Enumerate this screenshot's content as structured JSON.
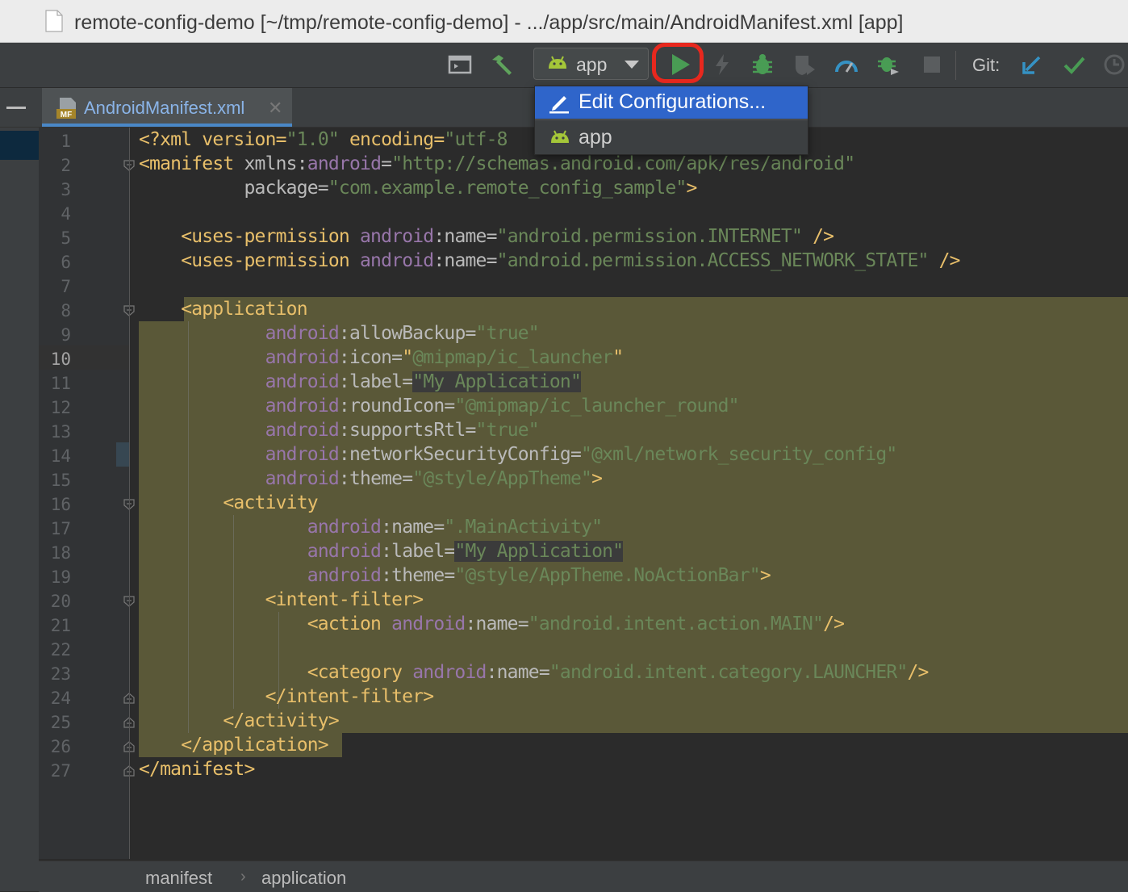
{
  "window": {
    "title": "remote-config-demo [~/tmp/remote-config-demo] - .../app/src/main/AndroidManifest.xml [app]"
  },
  "toolbar": {
    "config_value": "app",
    "git_label": "Git:",
    "icons": [
      "layout-icon",
      "build-hammer-icon",
      "android-icon",
      "chevron-down-icon",
      "run-play-icon",
      "apply-changes-icon",
      "debug-icon",
      "coverage-icon",
      "profile-icon",
      "attach-debugger-icon",
      "stop-icon",
      "git-update-icon",
      "git-commit-icon",
      "history-icon"
    ],
    "colors": {
      "run": "#499c54",
      "highlight": "#e8281e",
      "git_update": "#3592c4",
      "git_commit": "#499c54"
    }
  },
  "dropdown": {
    "items": [
      {
        "label": "Edit Configurations...",
        "icon": "pencil-icon",
        "selected": true
      },
      {
        "label": "app",
        "icon": "android-icon",
        "selected": false
      }
    ]
  },
  "tabs": [
    {
      "label": "AndroidManifest.xml",
      "icon": "mf-file-icon",
      "close": "✕",
      "active": true
    }
  ],
  "editor": {
    "current_line": 10,
    "line_numbers": [
      "1",
      "2",
      "3",
      "4",
      "5",
      "6",
      "7",
      "8",
      "9",
      "10",
      "11",
      "12",
      "13",
      "14",
      "15",
      "16",
      "17",
      "18",
      "19",
      "20",
      "21",
      "22",
      "23",
      "24",
      "25",
      "26",
      "27"
    ],
    "lines": [
      [
        [
          "t-tag",
          "<?xml version="
        ],
        [
          "t-val",
          "\"1.0\""
        ],
        [
          "t-tag",
          " encoding="
        ],
        [
          "t-val",
          "\"utf-8"
        ]
      ],
      [
        [
          "t-tag",
          "<manifest "
        ],
        [
          "t-attr",
          "xmlns:"
        ],
        [
          "t-ns",
          "android"
        ],
        [
          "t-attr",
          "="
        ],
        [
          "t-val",
          "\"http://schemas.android.com/apk/res/android\""
        ]
      ],
      [
        [
          "t-attr",
          "          package="
        ],
        [
          "t-val",
          "\"com.example.remote_config_sample\""
        ],
        [
          "t-tag",
          ">"
        ]
      ],
      [
        [
          "t-plain",
          ""
        ]
      ],
      [
        [
          "t-tag",
          "    <uses-permission "
        ],
        [
          "t-ns",
          "android"
        ],
        [
          "t-attr",
          ":name="
        ],
        [
          "t-val",
          "\"android.permission.INTERNET\""
        ],
        [
          "t-tag",
          " />"
        ]
      ],
      [
        [
          "t-tag",
          "    <uses-permission "
        ],
        [
          "t-ns",
          "android"
        ],
        [
          "t-attr",
          ":name="
        ],
        [
          "t-val",
          "\"android.permission.ACCESS_NETWORK_STATE\""
        ],
        [
          "t-tag",
          " />"
        ]
      ],
      [
        [
          "t-plain",
          ""
        ]
      ],
      [
        [
          "t-tag",
          "    <application"
        ]
      ],
      [
        [
          "t-plain",
          "            "
        ],
        [
          "t-ns",
          "android"
        ],
        [
          "t-attr",
          ":allowBackup="
        ],
        [
          "t-val",
          "\"true\""
        ]
      ],
      [
        [
          "t-plain",
          "            "
        ],
        [
          "t-ns",
          "android"
        ],
        [
          "t-attr",
          ":icon="
        ],
        [
          "t-tag",
          "\""
        ],
        [
          "t-val",
          "@mipmap/ic_launcher"
        ],
        [
          "t-tag",
          "\""
        ]
      ],
      [
        [
          "t-plain",
          "            "
        ],
        [
          "t-ns",
          "android"
        ],
        [
          "t-attr",
          ":label="
        ],
        [
          "t-val sel-bg",
          "\"My Application\""
        ]
      ],
      [
        [
          "t-plain",
          "            "
        ],
        [
          "t-ns",
          "android"
        ],
        [
          "t-attr",
          ":roundIcon="
        ],
        [
          "t-val",
          "\"@mipmap/ic_launcher_round\""
        ]
      ],
      [
        [
          "t-plain",
          "            "
        ],
        [
          "t-ns",
          "android"
        ],
        [
          "t-attr",
          ":supportsRtl="
        ],
        [
          "t-val",
          "\"true\""
        ]
      ],
      [
        [
          "t-plain",
          "            "
        ],
        [
          "t-ns",
          "android"
        ],
        [
          "t-attr",
          ":networkSecurityConfig="
        ],
        [
          "t-val",
          "\"@xml/network_security_config\""
        ]
      ],
      [
        [
          "t-plain",
          "            "
        ],
        [
          "t-ns",
          "android"
        ],
        [
          "t-attr",
          ":theme="
        ],
        [
          "t-val",
          "\"@style/AppTheme\""
        ],
        [
          "t-tag",
          ">"
        ]
      ],
      [
        [
          "t-tag",
          "        <activity"
        ]
      ],
      [
        [
          "t-plain",
          "                "
        ],
        [
          "t-ns",
          "android"
        ],
        [
          "t-attr",
          ":name="
        ],
        [
          "t-val",
          "\".MainActivity\""
        ]
      ],
      [
        [
          "t-plain",
          "                "
        ],
        [
          "t-ns",
          "android"
        ],
        [
          "t-attr",
          ":label="
        ],
        [
          "t-val sel-bg",
          "\"My Application\""
        ]
      ],
      [
        [
          "t-plain",
          "                "
        ],
        [
          "t-ns",
          "android"
        ],
        [
          "t-attr",
          ":theme="
        ],
        [
          "t-val",
          "\"@style/AppTheme.NoActionBar\""
        ],
        [
          "t-tag",
          ">"
        ]
      ],
      [
        [
          "t-tag",
          "            <intent-filter>"
        ]
      ],
      [
        [
          "t-tag",
          "                <action "
        ],
        [
          "t-ns",
          "android"
        ],
        [
          "t-attr",
          ":name="
        ],
        [
          "t-val",
          "\"android.intent.action.MAIN\""
        ],
        [
          "t-tag",
          "/>"
        ]
      ],
      [
        [
          "t-plain",
          ""
        ]
      ],
      [
        [
          "t-tag",
          "                <category "
        ],
        [
          "t-ns",
          "android"
        ],
        [
          "t-attr",
          ":name="
        ],
        [
          "t-val",
          "\"android.intent.category.LAUNCHER\""
        ],
        [
          "t-tag",
          "/>"
        ]
      ],
      [
        [
          "t-tag",
          "            </intent-filter>"
        ]
      ],
      [
        [
          "t-tag",
          "        </activity>"
        ]
      ],
      [
        [
          "t-tag",
          "    </application>"
        ]
      ],
      [
        [
          "t-tag",
          "</manifest>"
        ]
      ]
    ]
  },
  "breadcrumbs": [
    "manifest",
    "application"
  ],
  "breadcrumb_separator": "›"
}
